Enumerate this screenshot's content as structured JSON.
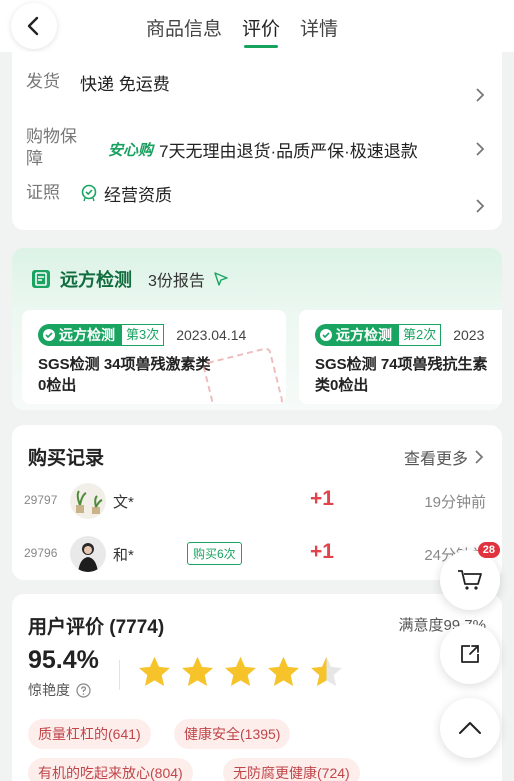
{
  "nav": {
    "tabs": [
      {
        "label": "商品信息",
        "active": false
      },
      {
        "label": "评价",
        "active": true
      },
      {
        "label": "详情",
        "active": false
      }
    ]
  },
  "info": {
    "shipping": {
      "label": "发货",
      "value": "快递 免运费"
    },
    "guarantee": {
      "label": "购物保障",
      "brand": "安心购",
      "value": "7天无理由退货·品质严保·极速退款"
    },
    "license": {
      "label": "证照",
      "value": "经营资质"
    }
  },
  "inspection": {
    "title": "远方检测",
    "count": "3份报告",
    "reports": [
      {
        "badge": "远方检测",
        "times": "第3次",
        "date": "2023.04.14",
        "text": "SGS检测 34项兽残激素类0检出"
      },
      {
        "badge": "远方检测",
        "times": "第2次",
        "date": "2023",
        "text": "SGS检测 74项兽残抗生素类0检出"
      }
    ]
  },
  "records": {
    "title": "购买记录",
    "more": "查看更多",
    "items": [
      {
        "id": "29797",
        "name": "文*",
        "tag": "",
        "plus": "+1",
        "time": "19分钟前"
      },
      {
        "id": "29796",
        "name": "和*",
        "tag": "购买6次",
        "plus": "+1",
        "time": "24分钟前"
      }
    ]
  },
  "reviews": {
    "title": "用户评价 (7774)",
    "satisfaction": "满意度99.7%",
    "score": "95.4%",
    "score_label": "惊艳度",
    "stars": 4.5,
    "tags": [
      "质量杠杠的(641)",
      "健康安全(1395)",
      "有机的吃起来放心(804)",
      "无防腐更健康(724)"
    ]
  },
  "float": {
    "cart_count": "28"
  },
  "colors": {
    "accent": "#17a35d",
    "price_red": "#e2434b",
    "star": "#f6c32b"
  }
}
